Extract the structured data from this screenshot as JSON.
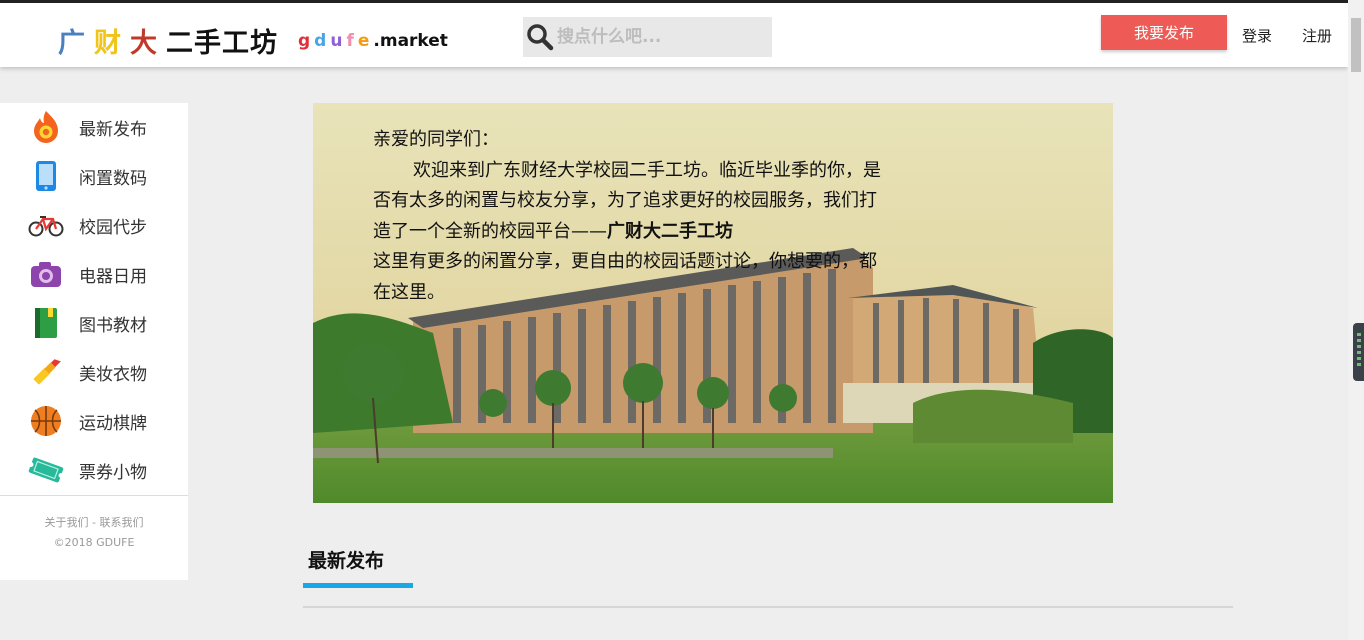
{
  "header": {
    "logo_chars": [
      "广",
      "财",
      "大",
      "二手工坊"
    ],
    "domain_letters": [
      "g",
      "d",
      "u",
      "f",
      "e",
      ".market"
    ],
    "search_placeholder": "搜点什么吧...",
    "publish_label": "我要发布",
    "login_label": "登录",
    "register_label": "注册"
  },
  "sidebar": {
    "items": [
      {
        "label": "最新发布",
        "icon": "fire-icon"
      },
      {
        "label": "闲置数码",
        "icon": "phone-icon"
      },
      {
        "label": "校园代步",
        "icon": "bicycle-icon"
      },
      {
        "label": "电器日用",
        "icon": "camera-icon"
      },
      {
        "label": "图书教材",
        "icon": "book-icon"
      },
      {
        "label": "美妆衣物",
        "icon": "lipstick-icon"
      },
      {
        "label": "运动棋牌",
        "icon": "basketball-icon"
      },
      {
        "label": "票券小物",
        "icon": "ticket-icon"
      }
    ],
    "footer_links": "关于我们 - 联系我们",
    "copyright": "©2018 GDUFE"
  },
  "banner": {
    "greeting": "亲爱的同学们：",
    "paragraph_lead": "欢迎来到广东财经大学校园二手工坊。临近毕业季的你，是否有太多的闲置与校友分享，为了追求更好的校园服务，我们打造了一个全新的校园平台——",
    "paragraph_bold": "广财大二手工坊",
    "paragraph_tail": "这里有更多的闲置分享，更自由的校园话题讨论，你想要的，都在这里。"
  },
  "section": {
    "title": "最新发布"
  },
  "colors": {
    "brand_red": "#ee5a55",
    "accent_blue": "#1aa7e6"
  }
}
